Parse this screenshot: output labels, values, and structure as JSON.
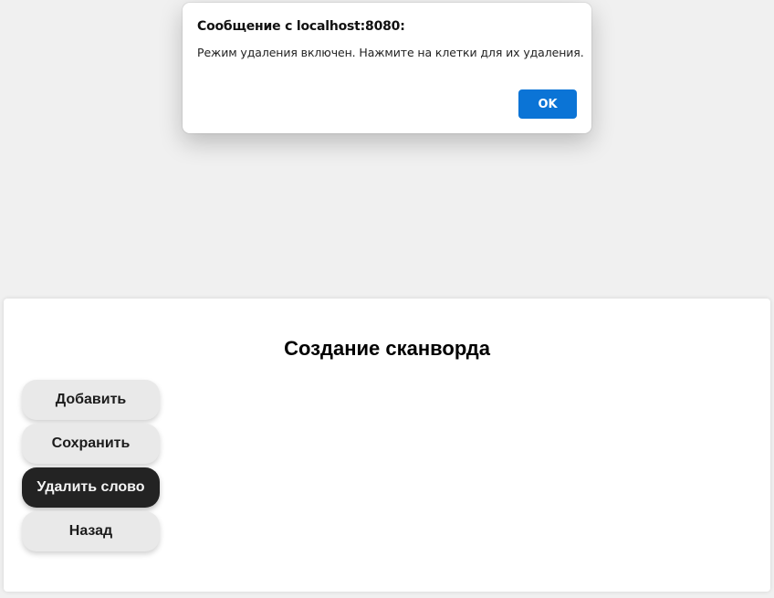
{
  "dialog": {
    "title": "Сообщение с localhost:8080:",
    "message": "Режим удаления включен. Нажмите на клетки для их удаления.",
    "ok_label": "OK",
    "accent_color": "#0b74d6"
  },
  "panel": {
    "title": "Создание сканворда",
    "buttons": {
      "add": "Добавить",
      "save": "Сохранить",
      "delete_word": "Удалить слово",
      "back": "Назад"
    },
    "active_button_color": "#232323"
  }
}
